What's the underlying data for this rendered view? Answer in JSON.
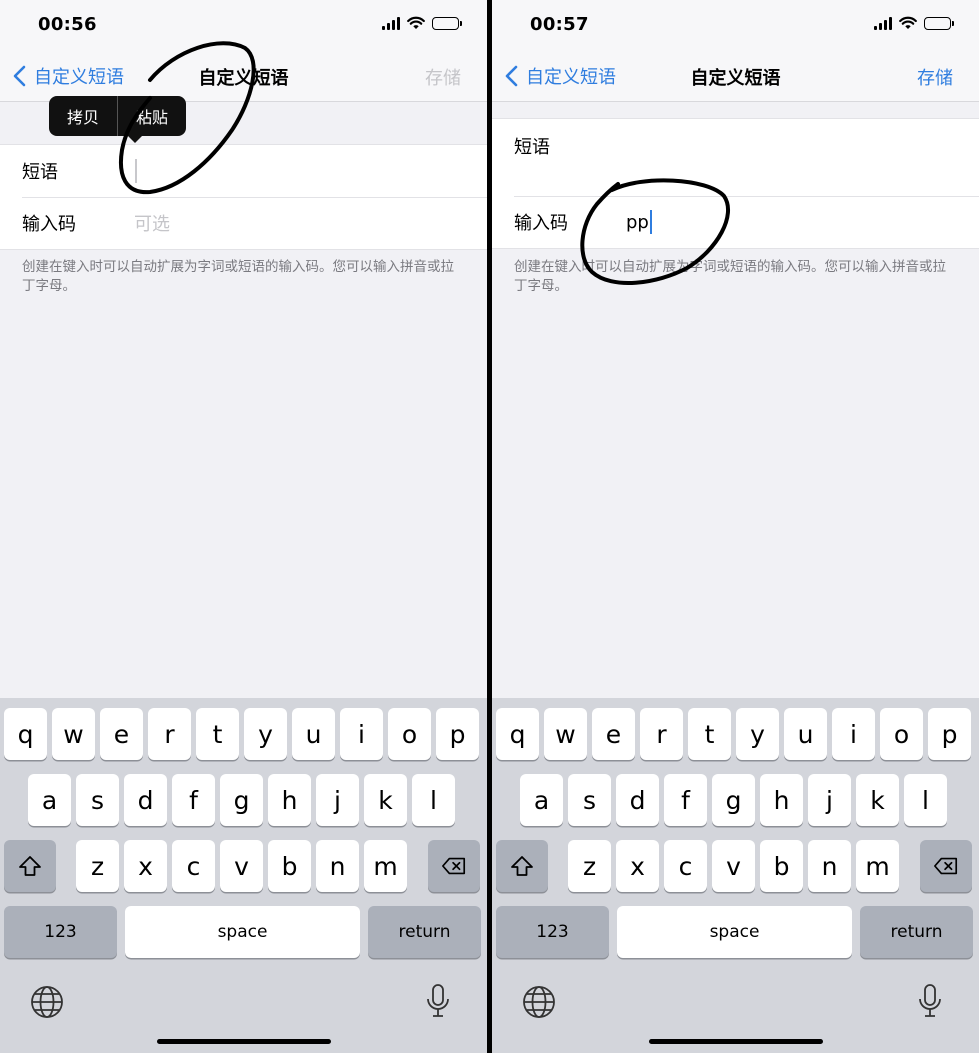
{
  "colors": {
    "accent": "#2f7ddf",
    "background": "#f1f1f5",
    "keyboard": "#d3d5db",
    "annotation": "#000000"
  },
  "left": {
    "status": {
      "time": "00:56"
    },
    "nav": {
      "back": "自定义短语",
      "title": "自定义短语",
      "save": "存储",
      "save_enabled": false
    },
    "edit_menu": {
      "copy": "拷贝",
      "paste": "粘贴"
    },
    "form": {
      "phrase_label": "短语",
      "phrase_value": "",
      "shortcut_label": "输入码",
      "shortcut_placeholder": "可选",
      "shortcut_value": ""
    },
    "footnote": "创建在键入时可以自动扩展为字词或短语的输入码。您可以输入拼音或拉丁字母。"
  },
  "right": {
    "status": {
      "time": "00:57"
    },
    "nav": {
      "back": "自定义短语",
      "title": "自定义短语",
      "save": "存储",
      "save_enabled": true
    },
    "form": {
      "phrase_label": "短语",
      "phrase_value": "",
      "shortcut_label": "输入码",
      "shortcut_value": "pp"
    },
    "footnote": "创建在键入时可以自动扩展为字词或短语的输入码。您可以输入拼音或拉丁字母。"
  },
  "keyboard": {
    "row1": [
      "q",
      "w",
      "e",
      "r",
      "t",
      "y",
      "u",
      "i",
      "o",
      "p"
    ],
    "row2": [
      "a",
      "s",
      "d",
      "f",
      "g",
      "h",
      "j",
      "k",
      "l"
    ],
    "row3": [
      "z",
      "x",
      "c",
      "v",
      "b",
      "n",
      "m"
    ],
    "numbers": "123",
    "space": "space",
    "return": "return"
  },
  "icons": [
    "chevron-left-icon",
    "signal-icon",
    "wifi-icon",
    "battery-icon",
    "shift-icon",
    "delete-icon",
    "globe-icon",
    "mic-icon"
  ]
}
